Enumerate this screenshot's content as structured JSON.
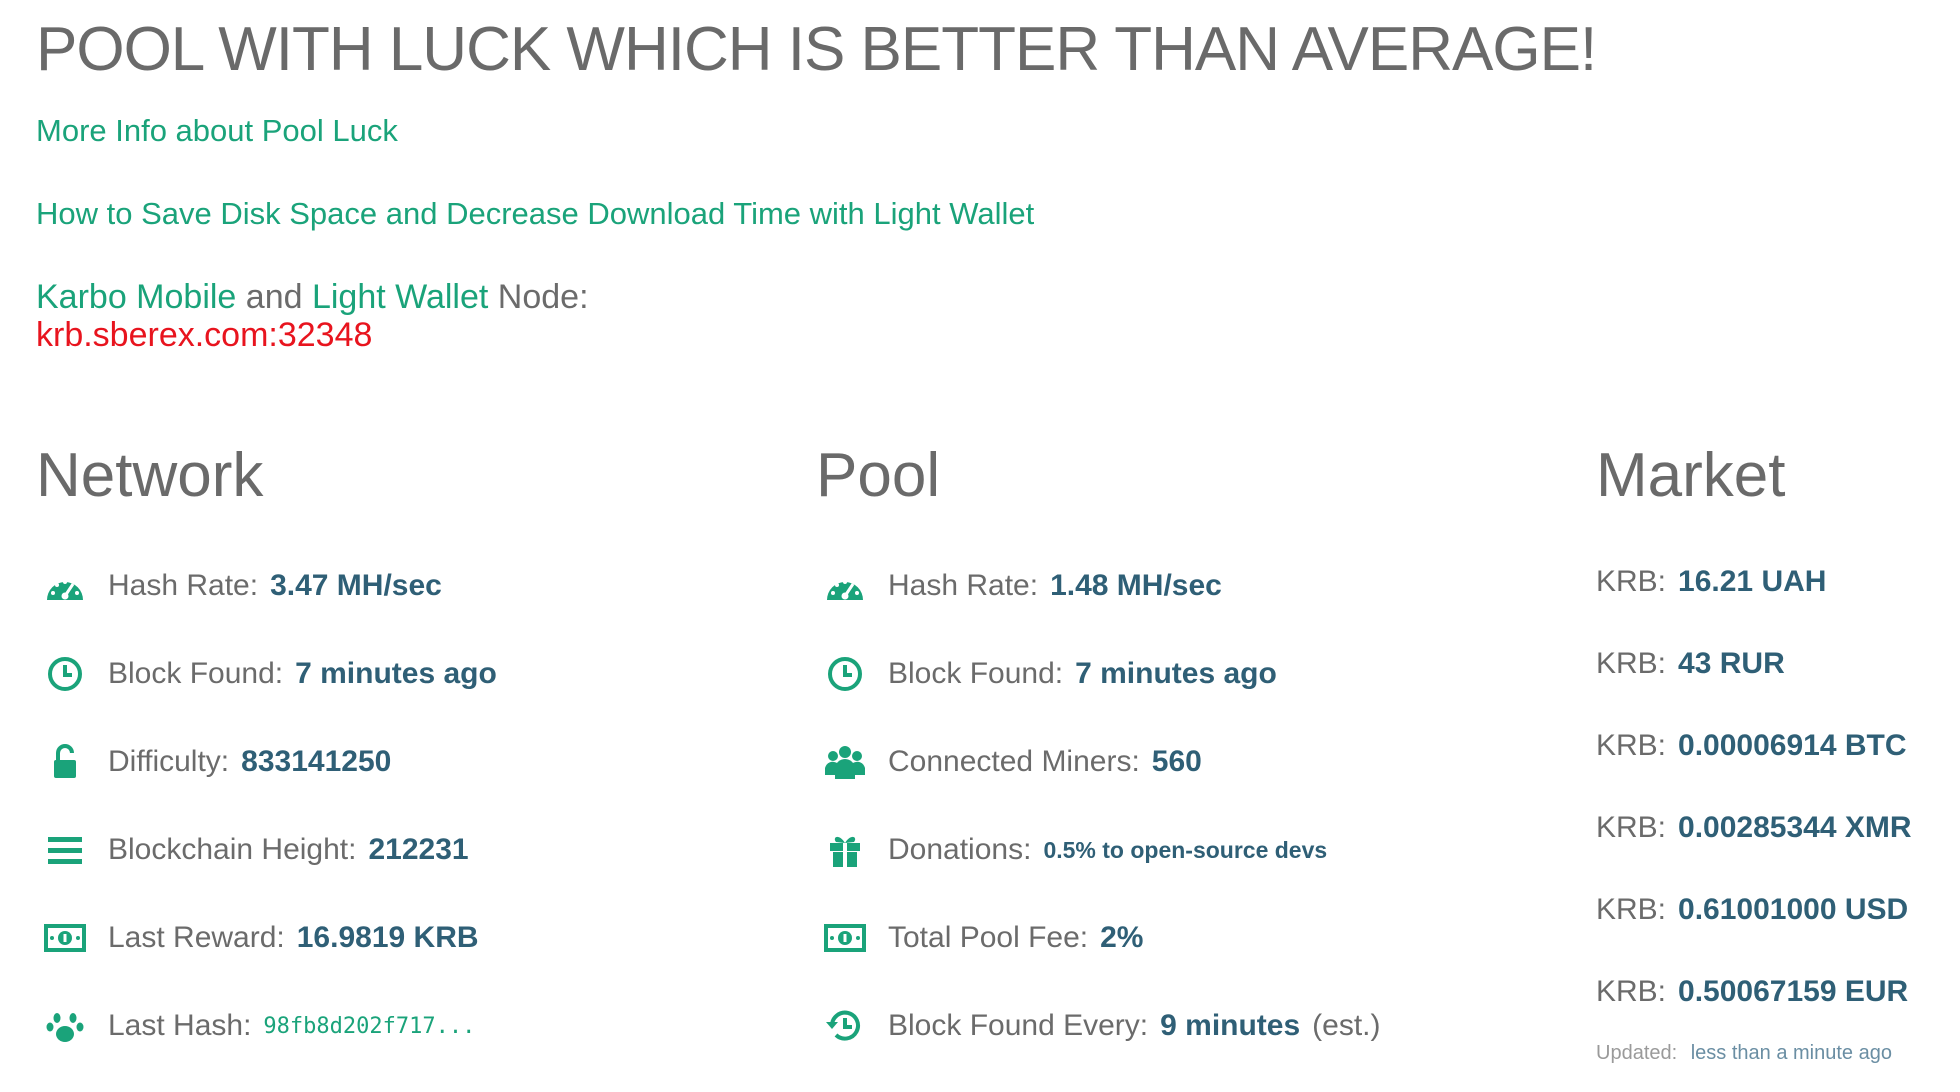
{
  "headline": "POOL WITH LUCK WHICH IS BETTER THAN AVERAGE!",
  "links": {
    "pool_luck": "More Info about Pool Luck",
    "light_wallet_guide": "How to Save Disk Space and Decrease Download Time with Light Wallet"
  },
  "node": {
    "karbo_mobile": "Karbo Mobile",
    "and": " and ",
    "light_wallet": "Light Wallet",
    "node_label": " Node:",
    "address": "krb.sberex.com:32348"
  },
  "network": {
    "title": "Network",
    "stats": [
      {
        "icon": "dashboard-icon",
        "label": "Hash Rate:",
        "value": "3.47 MH/sec"
      },
      {
        "icon": "clock-icon",
        "label": "Block Found:",
        "value": "7 minutes ago"
      },
      {
        "icon": "unlock-icon",
        "label": "Difficulty:",
        "value": "833141250"
      },
      {
        "icon": "bars-icon",
        "label": "Blockchain Height:",
        "value": "212231"
      },
      {
        "icon": "money-icon",
        "label": "Last Reward:",
        "value": "16.9819 KRB"
      },
      {
        "icon": "paw-icon",
        "label": "Last Hash:",
        "value": "98fb8d202f717..."
      }
    ]
  },
  "pool": {
    "title": "Pool",
    "stats": [
      {
        "icon": "dashboard-icon",
        "label": "Hash Rate:",
        "value": "1.48 MH/sec"
      },
      {
        "icon": "clock-icon",
        "label": "Block Found:",
        "value": "7 minutes ago"
      },
      {
        "icon": "users-icon",
        "label": "Connected Miners:",
        "value": "560"
      },
      {
        "icon": "gift-icon",
        "label": "Donations:",
        "value": "0.5% to open-source devs"
      },
      {
        "icon": "money-icon",
        "label": "Total Pool Fee:",
        "value": "2%"
      },
      {
        "icon": "history-icon",
        "label": "Block Found Every:",
        "value": "9 minutes",
        "suffix": "(est.)"
      }
    ]
  },
  "market": {
    "title": "Market",
    "rows": [
      {
        "label": "KRB:",
        "value": "16.21 UAH"
      },
      {
        "label": "KRB:",
        "value": "43 RUR"
      },
      {
        "label": "KRB:",
        "value": "0.00006914 BTC"
      },
      {
        "label": "KRB:",
        "value": "0.00285344 XMR"
      },
      {
        "label": "KRB:",
        "value": "0.61001000 USD"
      },
      {
        "label": "KRB:",
        "value": "0.50067159 EUR"
      }
    ],
    "updated_label": "Updated:",
    "updated_value": "less than a minute ago"
  },
  "colors": {
    "accent": "#1aa37a",
    "value": "#2f5f76",
    "node_address": "#e8141e",
    "text": "#6b6b6b"
  }
}
